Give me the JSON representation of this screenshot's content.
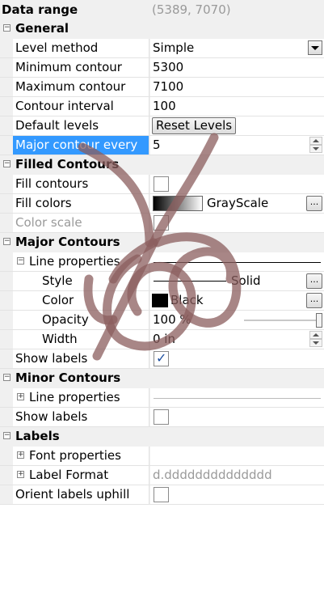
{
  "data_range": {
    "label": "Data range",
    "value": "(5389, 7070)"
  },
  "general": {
    "title": "General",
    "level_method": {
      "label": "Level method",
      "value": "Simple"
    },
    "minimum_contour": {
      "label": "Minimum contour",
      "value": "5300"
    },
    "maximum_contour": {
      "label": "Maximum contour",
      "value": "7100"
    },
    "contour_interval": {
      "label": "Contour interval",
      "value": "100"
    },
    "default_levels": {
      "label": "Default levels",
      "button": "Reset Levels"
    },
    "major_contour_every": {
      "label": "Major contour every",
      "value": "5"
    }
  },
  "filled_contours": {
    "title": "Filled Contours",
    "fill_contours": {
      "label": "Fill contours",
      "checked": false
    },
    "fill_colors": {
      "label": "Fill colors",
      "value": "GrayScale",
      "button": "..."
    },
    "color_scale": {
      "label": "Color scale"
    }
  },
  "major_contours": {
    "title": "Major Contours",
    "line_properties": {
      "label": "Line properties"
    },
    "style": {
      "label": "Style",
      "value": "Solid",
      "button": "..."
    },
    "color": {
      "label": "Color",
      "value": "Black",
      "button": "..."
    },
    "opacity": {
      "label": "Opacity",
      "value": "100 %"
    },
    "width": {
      "label": "Width",
      "value": "0 in"
    },
    "show_labels": {
      "label": "Show labels",
      "checked": true
    }
  },
  "minor_contours": {
    "title": "Minor Contours",
    "line_properties": {
      "label": "Line properties"
    },
    "show_labels": {
      "label": "Show labels",
      "checked": false
    }
  },
  "labels": {
    "title": "Labels",
    "font_properties": {
      "label": "Font properties"
    },
    "label_format": {
      "label": "Label Format",
      "value": "d.dddddddddddddd"
    },
    "orient_labels_uphill": {
      "label": "Orient labels uphill",
      "checked": false
    }
  },
  "icons": {
    "collapse": "collapse-icon",
    "expand": "expand-icon"
  },
  "colors": {
    "selection": "#3399ff",
    "ink": "#8b5e5e"
  }
}
